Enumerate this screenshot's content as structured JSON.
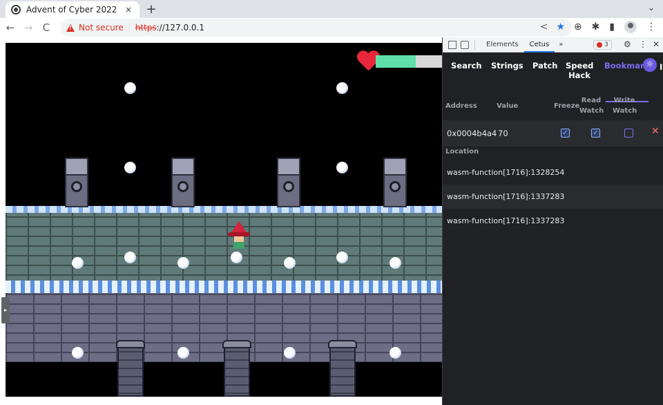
{
  "browser": {
    "tab_title": "Advent of Cyber 2022",
    "tab_close": "×",
    "new_tab": "+",
    "tab_list": "⌄",
    "back": "←",
    "forward": "→",
    "reload": "C",
    "security_label": "Not secure",
    "url_scheme": "https",
    "url_rest": "://127.0.0.1",
    "share": "<",
    "star": "★",
    "ext1": "⊕",
    "ext2": "✱",
    "sidepanel": "▮",
    "menu": "⋮"
  },
  "game": {
    "health_fraction": 0.6
  },
  "devtools": {
    "tabs": [
      "Elements",
      "Cetus"
    ],
    "active_tab": "Cetus",
    "more": "»",
    "error_count": "3",
    "gear": "⚙",
    "menu": "⋮",
    "close": "✕"
  },
  "cetus": {
    "tabs": {
      "search": "Search",
      "strings": "Strings",
      "patch": "Patch",
      "speed_hack": "Speed Hack",
      "bookmarks": "Bookmark",
      "cut": "I"
    },
    "columns": {
      "address": "Address",
      "value": "Value",
      "freeze": "Freeze",
      "read_watch": "Read Watch",
      "write_watch": "Write Watch"
    },
    "bookmark": {
      "address": "0x0004b4a4",
      "value": "70",
      "freeze": true,
      "read_watch": true,
      "write_watch": false,
      "delete": "✕"
    },
    "location_label": "Location",
    "locations": [
      "wasm-function[1716]:1328254",
      "wasm-function[1716]:1337283",
      "wasm-function[1716]:1337283"
    ]
  }
}
